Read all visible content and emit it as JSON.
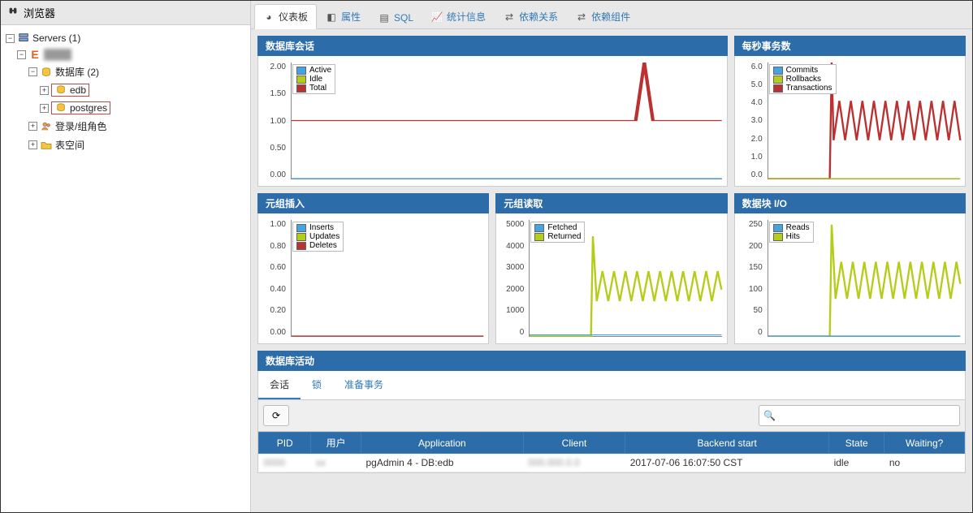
{
  "sidebar": {
    "title": "浏览器",
    "servers_label": "Servers (1)",
    "server_name_blurred": "████",
    "db_group": "数据库 (2)",
    "db1": "edb",
    "db2": "postgres",
    "roles": "登录/组角色",
    "tablespaces": "表空间"
  },
  "tabs": {
    "dashboard": "仪表板",
    "properties": "属性",
    "sql": "SQL",
    "stats": "统计信息",
    "deps": "依赖关系",
    "dependents": "依赖组件"
  },
  "panels": {
    "sessions": {
      "title": "数据库会话",
      "legend": [
        "Active",
        "Idle",
        "Total"
      ],
      "yticks": [
        "2.00",
        "1.50",
        "1.00",
        "0.50",
        "0.00"
      ]
    },
    "tps": {
      "title": "每秒事务数",
      "legend": [
        "Commits",
        "Rollbacks",
        "Transactions"
      ],
      "yticks": [
        "6.0",
        "5.0",
        "4.0",
        "3.0",
        "2.0",
        "1.0",
        "0.0"
      ]
    },
    "tuples_in": {
      "title": "元组插入",
      "legend": [
        "Inserts",
        "Updates",
        "Deletes"
      ],
      "yticks": [
        "1.00",
        "0.80",
        "0.60",
        "0.40",
        "0.20",
        "0.00"
      ]
    },
    "tuples_out": {
      "title": "元组读取",
      "legend": [
        "Fetched",
        "Returned"
      ],
      "yticks": [
        "5000",
        "4000",
        "3000",
        "2000",
        "1000",
        "0"
      ]
    },
    "block_io": {
      "title": "数据块 I/O",
      "legend": [
        "Reads",
        "Hits"
      ],
      "yticks": [
        "250",
        "200",
        "150",
        "100",
        "50",
        "0"
      ]
    }
  },
  "activity": {
    "title": "数据库活动",
    "tabs": {
      "sessions": "会话",
      "locks": "锁",
      "prepared": "准备事务"
    },
    "columns": [
      "PID",
      "用户",
      "Application",
      "Client",
      "Backend start",
      "State",
      "Waiting?"
    ],
    "rows": [
      {
        "pid": "",
        "user": "",
        "app": "pgAdmin 4 - DB:edb",
        "client": "",
        "start": "2017-07-06 16:07:50 CST",
        "state": "idle",
        "waiting": "no"
      }
    ]
  },
  "colors": {
    "blue": "#44a3e0",
    "green": "#b5cc18",
    "red": "#bb3030",
    "header": "#2c6ca8"
  },
  "chart_data": [
    {
      "id": "sessions",
      "type": "line",
      "ylim": [
        0,
        2
      ],
      "series": [
        {
          "name": "Active",
          "approx": "flat at 0"
        },
        {
          "name": "Idle",
          "approx": "flat at 0"
        },
        {
          "name": "Total",
          "approx": "flat at 1.0 with one spike to 2.0 near x≈0.82"
        }
      ]
    },
    {
      "id": "tps",
      "type": "line",
      "ylim": [
        0,
        6
      ],
      "series": [
        {
          "name": "Commits",
          "approx": "flat at 0"
        },
        {
          "name": "Rollbacks",
          "approx": "flat at 0"
        },
        {
          "name": "Transactions",
          "approx": "spike to 6 at x≈0.33 then oscillates 2↔4 for rest"
        }
      ]
    },
    {
      "id": "tuples_in",
      "type": "line",
      "ylim": [
        0,
        1
      ],
      "series": [
        {
          "name": "Inserts",
          "approx": "flat at 0"
        },
        {
          "name": "Updates",
          "approx": "flat at 0"
        },
        {
          "name": "Deletes",
          "approx": "flat at 0"
        }
      ]
    },
    {
      "id": "tuples_out",
      "type": "line",
      "ylim": [
        0,
        5000
      ],
      "series": [
        {
          "name": "Fetched",
          "approx": "near 0"
        },
        {
          "name": "Returned",
          "approx": "spike ~4300 at x≈0.33 then oscillates ~1500↔2800"
        }
      ]
    },
    {
      "id": "block_io",
      "type": "line",
      "ylim": [
        0,
        250
      ],
      "series": [
        {
          "name": "Reads",
          "approx": "flat at 0"
        },
        {
          "name": "Hits",
          "approx": "spike ~240 at x≈0.33 then oscillates ~80↔160"
        }
      ]
    }
  ]
}
